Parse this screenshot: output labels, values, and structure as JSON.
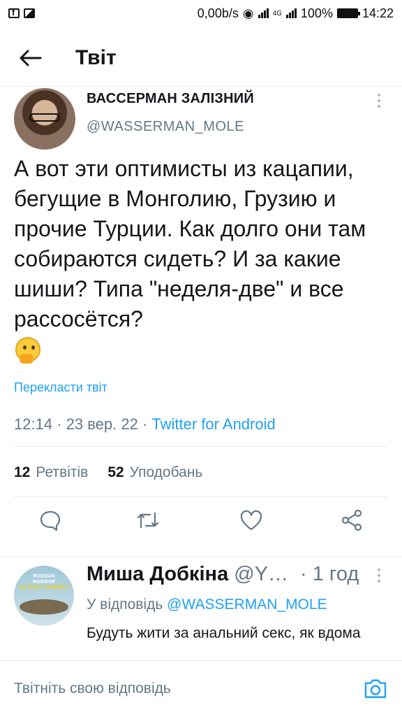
{
  "status_bar": {
    "network_speed": "0,00b/s",
    "network_type": "4G",
    "battery": "100%",
    "time": "14:22"
  },
  "header": {
    "title": "Твіт"
  },
  "tweet": {
    "author_name": "ВАССЕРМАН ЗАЛІЗНИЙ",
    "author_handle": "@WASSERMAN_MOLE",
    "text": "А вот эти оптимисты из кацапии, бегущие в Монголию, Грузию и прочие Турции. Как долго они там собираются сидеть? И за какие шиши? Типа \"неделя-две\" и все рассосётся?",
    "emoji": "thinking-face",
    "translate_label": "Перекласти твіт",
    "time": "12:14",
    "date": "23 вер. 22",
    "source": "Twitter for Android",
    "retweets_count": "12",
    "retweets_label": "Ретвітів",
    "likes_count": "52",
    "likes_label": "Уподобань"
  },
  "actions": [
    "reply-icon",
    "retweet-icon",
    "like-icon",
    "share-icon"
  ],
  "reply": {
    "author_name": "Миша Добкіна",
    "author_handle": "@Y…",
    "time": "· 1 год",
    "reply_to_label": "У відповідь",
    "reply_to_handle": "@WASSERMAN_MOLE",
    "text": "Будуть жити за анальний секс, як вдома",
    "avatar_text": [
      "RUSSIAN",
      "WARSHIP",
      "GO FUCK YOURSELF"
    ]
  },
  "composer": {
    "placeholder": "Твітніть свою відповідь"
  },
  "colors": {
    "accent": "#1da1f2",
    "secondary_text": "#657786",
    "divider": "#e6ecf0"
  }
}
